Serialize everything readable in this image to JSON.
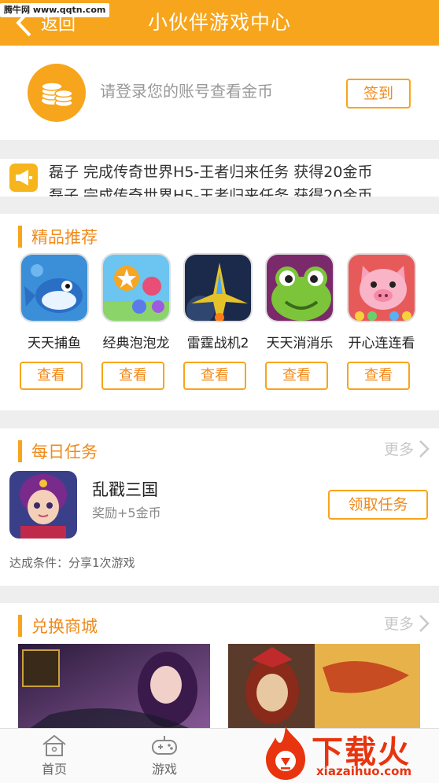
{
  "watermark": "腾牛网 www.qqtn.com",
  "header": {
    "back_label": "返回",
    "title": "小伙伴游戏中心"
  },
  "login": {
    "prompt": "请登录您的账号查看金币",
    "signin_label": "签到"
  },
  "notice": {
    "line1": "磊子 完成传奇世界H5-王者归来任务 获得20金币",
    "line2": "磊子 完成传奇世界H5-王者归来任务 获得20金币"
  },
  "recommend": {
    "title": "精品推荐",
    "view_label": "查看",
    "games": [
      {
        "name": "天天捕鱼"
      },
      {
        "name": "经典泡泡龙"
      },
      {
        "name": "雷霆战机2"
      },
      {
        "name": "天天消消乐"
      },
      {
        "name": "开心连连看"
      }
    ]
  },
  "daily": {
    "title": "每日任务",
    "more": "更多",
    "task": {
      "name": "乱戳三国",
      "reward": "奖励+5金币",
      "button": "领取任务",
      "condition": "达成条件：分享1次游戏"
    }
  },
  "shop": {
    "title": "兑换商城",
    "more": "更多"
  },
  "tabs": [
    {
      "label": "首页"
    },
    {
      "label": "游戏"
    }
  ],
  "logo": {
    "text": "下载火",
    "sub": "xiazaihuo.com"
  },
  "colors": {
    "accent": "#f7a51c",
    "accent_text": "#f08a1a",
    "background": "#eeeeee"
  }
}
